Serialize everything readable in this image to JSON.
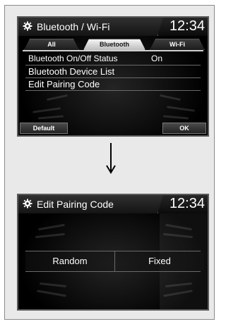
{
  "screen1": {
    "title": "Bluetooth / Wi-Fi",
    "clock": "12:34",
    "icon": "gear-icon",
    "tabs": [
      {
        "label": "All",
        "active": false
      },
      {
        "label": "Bluetooth",
        "active": true
      },
      {
        "label": "Wi-Fi",
        "active": false
      }
    ],
    "rows": [
      {
        "label": "Bluetooth On/Off Status",
        "value": "On"
      },
      {
        "label": "Bluetooth Device List",
        "value": ""
      },
      {
        "label": "Edit Pairing Code",
        "value": ""
      }
    ],
    "buttons": {
      "default_label": "Default",
      "ok_label": "OK"
    }
  },
  "arrow": {
    "icon": "down-arrow-icon"
  },
  "screen2": {
    "title": "Edit Pairing Code",
    "clock": "12:34",
    "icon": "gear-icon",
    "options": [
      {
        "label": "Random"
      },
      {
        "label": "Fixed"
      }
    ]
  },
  "colors": {
    "background": "#000000",
    "text": "#ffffff",
    "active_tab": "#d9d9d9",
    "frame": "#e9e9e9"
  }
}
